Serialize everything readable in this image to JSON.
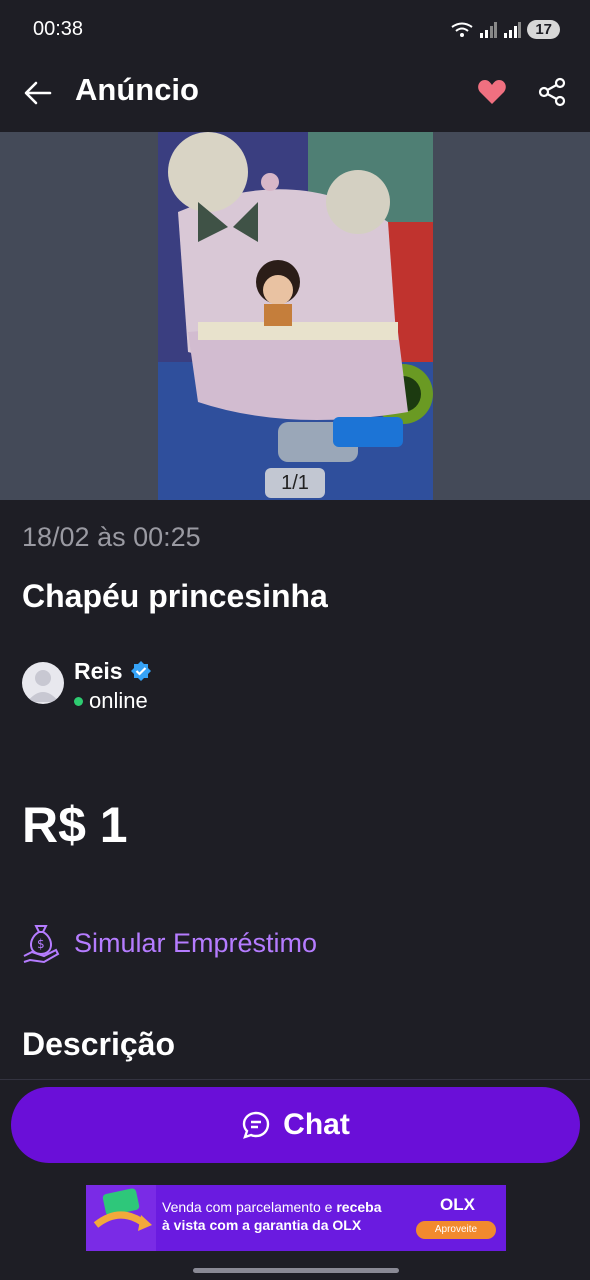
{
  "status_bar": {
    "time": "00:38",
    "battery": "17"
  },
  "app_bar": {
    "title": "Anúncio"
  },
  "gallery": {
    "counter": "1/1"
  },
  "listing": {
    "date": "18/02 às 00:25",
    "title": "Chapéu princesinha",
    "price": "R$ 1"
  },
  "seller": {
    "name": "Reis",
    "status": "online"
  },
  "loan": {
    "label": "Simular Empréstimo"
  },
  "description": {
    "heading": "Descrição"
  },
  "chat_button": {
    "label": "Chat"
  },
  "banner": {
    "line1_a": "Venda com parcelamento e ",
    "line1_b": "receba",
    "line2": "à vista com a garantia da OLX",
    "logo": "OLX",
    "cta": "Aproveite"
  },
  "colors": {
    "accent": "#6a0fd8",
    "link": "#b57cff",
    "heart": "#f07080",
    "verified": "#36a3f7",
    "online": "#2ecc71"
  },
  "icons": [
    "back-arrow-icon",
    "heart-icon",
    "share-icon",
    "verified-icon",
    "money-bag-icon",
    "chat-bubble-icon",
    "wifi-icon",
    "signal-icon"
  ]
}
